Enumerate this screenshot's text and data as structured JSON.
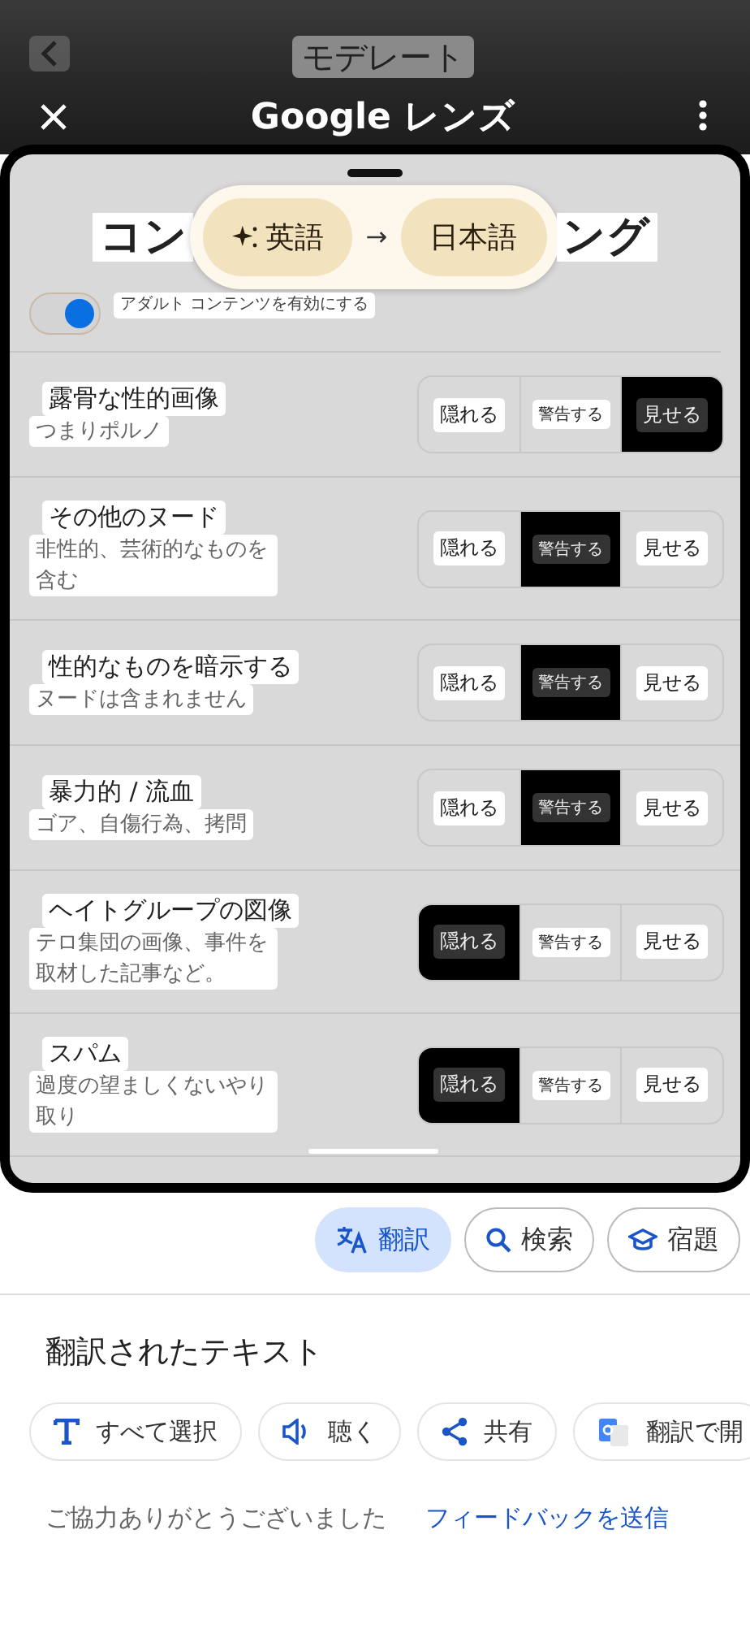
{
  "camera_view": {
    "captured_header": "モデレート",
    "app_title": "Google レンズ"
  },
  "language_pill": {
    "source": "英語",
    "arrow": "→",
    "target": "日本語"
  },
  "card": {
    "title_left": "コン",
    "title_right": "ング",
    "toggle": {
      "label": "アダルト コンテンツを有効にする",
      "on": true
    },
    "rows": [
      {
        "title": "露骨な性的画像",
        "subtitle": "つまりポルノ",
        "options": [
          {
            "label": "隠れる",
            "selected": false
          },
          {
            "label": "警告する",
            "selected": false
          },
          {
            "label": "見せる",
            "selected": true
          }
        ]
      },
      {
        "title": "その他のヌード",
        "subtitle": "非性的、芸術的なものを含む",
        "options": [
          {
            "label": "隠れる",
            "selected": false
          },
          {
            "label": "警告する",
            "selected": true
          },
          {
            "label": "見せる",
            "selected": false
          }
        ]
      },
      {
        "title": "性的なものを暗示する",
        "subtitle": "ヌードは含まれません",
        "options": [
          {
            "label": "隠れる",
            "selected": false
          },
          {
            "label": "警告する",
            "selected": true
          },
          {
            "label": "見せる",
            "selected": false
          }
        ]
      },
      {
        "title": "暴力的 / 流血",
        "subtitle": "ゴア、自傷行為、拷問",
        "options": [
          {
            "label": "隠れる",
            "selected": false
          },
          {
            "label": "警告する",
            "selected": true
          },
          {
            "label": "見せる",
            "selected": false
          }
        ]
      },
      {
        "title": "ヘイトグループの図像",
        "subtitle": "テロ集団の画像、事件を取材した記事など。",
        "options": [
          {
            "label": "隠れる",
            "selected": true
          },
          {
            "label": "警告する",
            "selected": false
          },
          {
            "label": "見せる",
            "selected": false
          }
        ]
      },
      {
        "title": "スパム",
        "subtitle": "過度の望ましくないやり取り",
        "options": [
          {
            "label": "隠れる",
            "selected": true
          },
          {
            "label": "警告する",
            "selected": false
          },
          {
            "label": "見せる",
            "selected": false
          }
        ]
      }
    ]
  },
  "mode_chips": [
    {
      "kind": "translate",
      "label": "翻訳",
      "selected": true
    },
    {
      "kind": "search",
      "label": "検索",
      "selected": false
    },
    {
      "kind": "homework",
      "label": "宿題",
      "selected": false
    }
  ],
  "translated_heading": "翻訳されたテキスト",
  "actions": [
    {
      "kind": "select",
      "label": "すべて選択"
    },
    {
      "kind": "listen",
      "label": "聴く"
    },
    {
      "kind": "share",
      "label": "共有"
    },
    {
      "kind": "open",
      "label": "翻訳で開"
    }
  ],
  "footer": {
    "thanks": "ご協力ありがとうございました",
    "feedback_link": "フィードバックを送信"
  }
}
